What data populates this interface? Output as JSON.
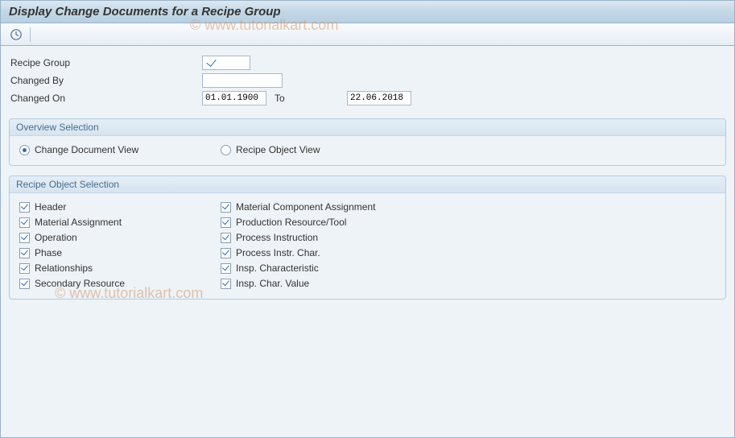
{
  "title": "Display Change Documents for a Recipe Group",
  "watermark": "© www.tutorialkart.com",
  "toolbar": {
    "execute_icon": "clock-execute-icon"
  },
  "form": {
    "recipe_group": {
      "label": "Recipe Group",
      "value": ""
    },
    "changed_by": {
      "label": "Changed By",
      "value": ""
    },
    "changed_on": {
      "label": "Changed On",
      "from": "01.01.1900",
      "to_label": "To",
      "to": "22.06.2018"
    }
  },
  "overview": {
    "title": "Overview Selection",
    "options": [
      {
        "label": "Change Document View",
        "selected": true
      },
      {
        "label": "Recipe Object View",
        "selected": false
      }
    ]
  },
  "recipe_obj": {
    "title": "Recipe Object Selection",
    "col1": [
      {
        "label": "Header",
        "checked": true
      },
      {
        "label": "Material Assignment",
        "checked": true
      },
      {
        "label": "Operation",
        "checked": true
      },
      {
        "label": "Phase",
        "checked": true
      },
      {
        "label": "Relationships",
        "checked": true
      },
      {
        "label": "Secondary Resource",
        "checked": true
      }
    ],
    "col2": [
      {
        "label": "Material Component Assignment",
        "checked": true
      },
      {
        "label": "Production Resource/Tool",
        "checked": true
      },
      {
        "label": "Process Instruction",
        "checked": true
      },
      {
        "label": "Process Instr. Char.",
        "checked": true
      },
      {
        "label": "Insp. Characteristic",
        "checked": true
      },
      {
        "label": "Insp. Char. Value",
        "checked": true
      }
    ]
  }
}
